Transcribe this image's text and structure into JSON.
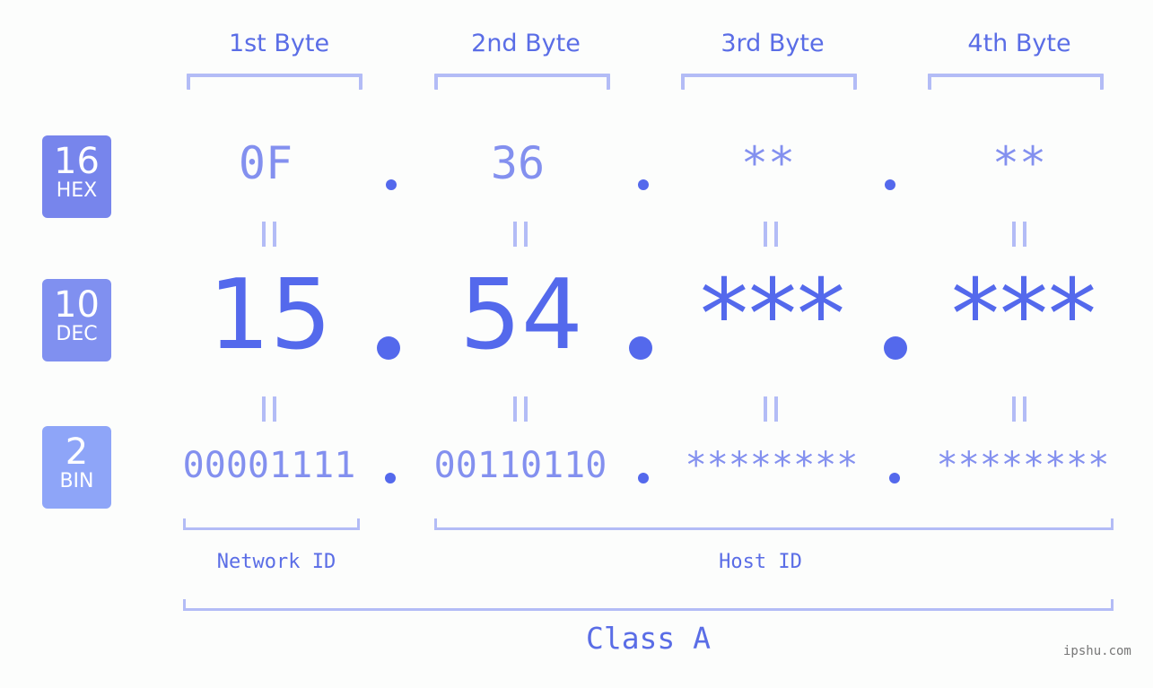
{
  "byte_headers": [
    "1st Byte",
    "2nd Byte",
    "3rd Byte",
    "4th Byte"
  ],
  "badges": [
    {
      "num": "16",
      "label": "HEX",
      "color": "#7785ec"
    },
    {
      "num": "10",
      "label": "DEC",
      "color": "#8090f0"
    },
    {
      "num": "2",
      "label": "BIN",
      "color": "#8ea5f8"
    }
  ],
  "hex": [
    "0F",
    "36",
    "**",
    "**"
  ],
  "dec": [
    "15",
    "54",
    "***",
    "***"
  ],
  "bin": [
    "00001111",
    "00110110",
    "********",
    "********"
  ],
  "network_label": "Network ID",
  "host_label": "Host ID",
  "class_label": "Class A",
  "watermark": "ipshu.com",
  "colors": {
    "accent": "#5469ec",
    "light": "#b3bcf6",
    "mid": "#8390ef"
  }
}
